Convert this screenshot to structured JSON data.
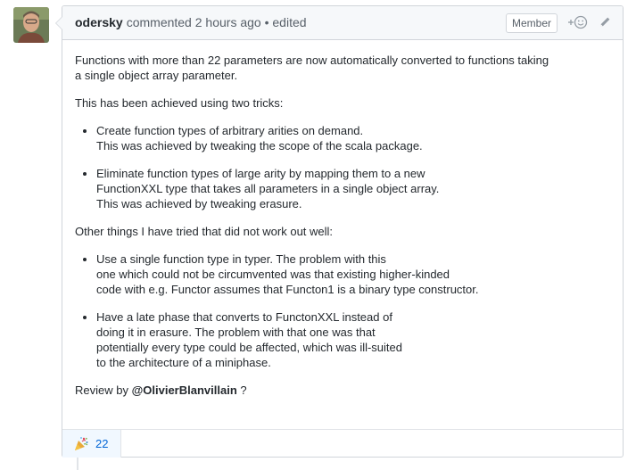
{
  "comment": {
    "author": "odersky",
    "action": "commented",
    "time": "2 hours ago",
    "edited_separator": "•",
    "edited": "edited",
    "badge": "Member",
    "add_reaction_icon": "smiley-plus-icon",
    "edit_icon": "pencil-icon"
  },
  "body": {
    "p1": "Functions with more than 22 parameters are now automatically converted to functions taking\na single object array parameter.",
    "p2": "This has been achieved using two tricks:",
    "tricks": [
      "Create function types of arbitrary arities on demand.\nThis was achieved by tweaking the scope of the scala package.",
      "Eliminate function types of large arity by mapping them to a new\nFunctionXXL type that takes all parameters in a single object array.\nThis was achieved by tweaking erasure."
    ],
    "p3": "Other things I have tried that did not work out well:",
    "failed": [
      "Use a single function type in typer. The problem with this\none which could not be circumvented was that existing higher-kinded\ncode with e.g. Functor assumes that Functon1 is a binary type constructor.",
      "Have a late phase that converts to FunctonXXL instead of\ndoing it in erasure. The problem with that one was that\npotentially every type could be affected, which was ill-suited\nto the architecture of a miniphase."
    ],
    "review_prefix": "Review by",
    "review_mention": "@OlivierBlanvillain",
    "review_suffix": " ?"
  },
  "reactions": [
    {
      "icon": "tada-icon",
      "count": "22"
    }
  ],
  "colors": {
    "header_bg": "#f6f8fa",
    "border": "#d1d5da",
    "link": "#0366d6",
    "reaction_bg": "#f1f8ff"
  }
}
